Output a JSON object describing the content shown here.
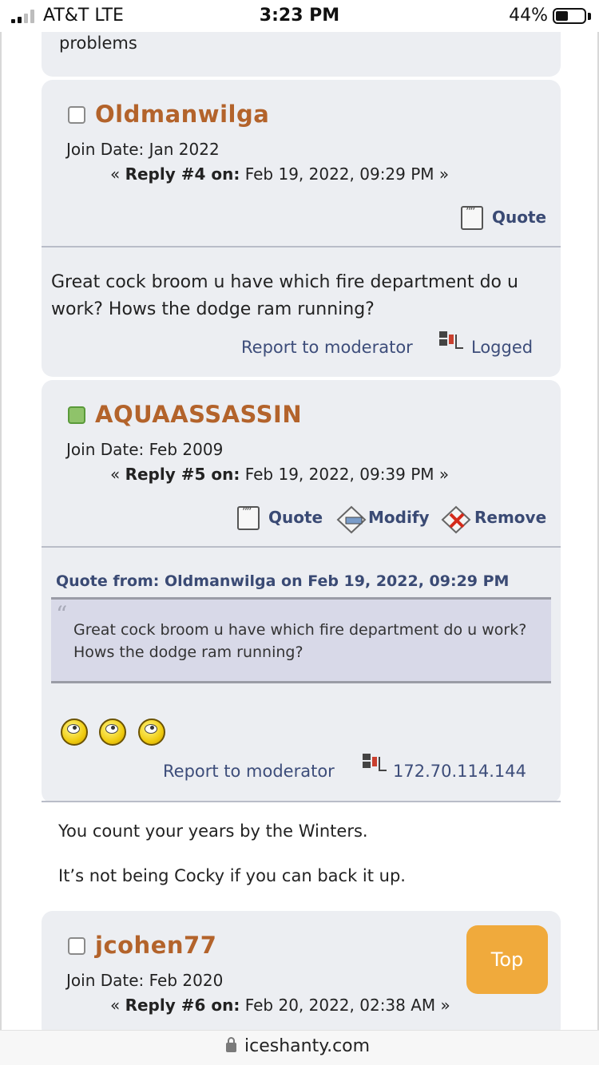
{
  "status_bar": {
    "carrier": "AT&T  LTE",
    "time": "3:23 PM",
    "battery_percent": "44%",
    "battery_level": 0.44,
    "signal_bars": 2
  },
  "previous_post": {
    "tail_text": "problems"
  },
  "posts": [
    {
      "username": "Oldmanwilga",
      "online": false,
      "join_date": "Join Date: Jan 2022",
      "reply_label": "Reply #4 on:",
      "reply_date": "Feb 19, 2022, 09:29 PM",
      "quote_label": "Quote",
      "body": "Great cock broom u have which fire department do u work? Hows the dodge ram running?",
      "report_label": "Report to moderator",
      "logged_label": "Logged"
    },
    {
      "username": "AQUAASSASSIN",
      "online": true,
      "join_date": "Join Date: Feb 2009",
      "reply_label": "Reply #5 on:",
      "reply_date": "Feb 19, 2022, 09:39 PM",
      "quote_label": "Quote",
      "modify_label": "Modify",
      "remove_label": "Remove",
      "quote_header": "Quote from: Oldmanwilga on Feb 19, 2022, 09:29 PM",
      "quote_text": "Great cock broom u have which fire department do u work? Hows the dodge ram running?",
      "smileys": [
        "smiley-icon",
        "smiley-icon",
        "smiley-icon"
      ],
      "report_label": "Report to moderator",
      "ip_address": "172.70.114.144",
      "signature": [
        "You count your years by the Winters.",
        "It’s not being Cocky if you can back it up."
      ]
    },
    {
      "username": "jcohen77",
      "online": false,
      "join_date": "Join Date: Feb 2020",
      "reply_label": "Reply #6 on:",
      "reply_date": "Feb 20, 2022, 02:38 AM"
    }
  ],
  "top_button": {
    "label": "Top",
    "color": "#f0aa3c"
  },
  "address_bar": {
    "url": "iceshanty.com"
  },
  "colors": {
    "username": "#b3632b",
    "link": "#3d4d7a",
    "card_bg": "#eceef2",
    "online": "#8fc36a"
  }
}
